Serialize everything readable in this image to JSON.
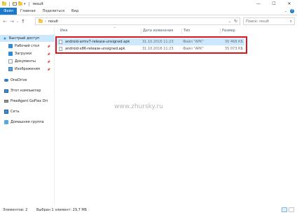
{
  "window": {
    "title": "result",
    "controls": {
      "minimize": "—",
      "maximize": "☐",
      "close": "✕"
    }
  },
  "ribbon": {
    "tabs": [
      "Файл",
      "Главная",
      "Поделиться",
      "Вид"
    ],
    "expand": "⌄",
    "help": "?"
  },
  "address": {
    "breadcrumb": "result",
    "search_placeholder": "Поиск: result"
  },
  "sidebar": {
    "items": [
      {
        "label": "Быстрый доступ",
        "icon": "star-icon",
        "selected": true,
        "pinned": false
      },
      {
        "label": "Рабочий стол",
        "icon": "desktop-icon",
        "pinned": true
      },
      {
        "label": "Загрузки",
        "icon": "downloads-icon",
        "pinned": true
      },
      {
        "label": "Документы",
        "icon": "documents-icon",
        "pinned": true
      },
      {
        "label": "Изображения",
        "icon": "pictures-icon",
        "pinned": true
      },
      {
        "label": "OneDrive",
        "icon": "cloud-icon"
      },
      {
        "label": "Этот компьютер",
        "icon": "computer-icon"
      },
      {
        "label": "FreeAgent GoFlex Dri",
        "icon": "drive-icon"
      },
      {
        "label": "Сеть",
        "icon": "network-icon"
      },
      {
        "label": "Домашняя группа",
        "icon": "homegroup-icon"
      }
    ]
  },
  "columns": {
    "name": "Имя",
    "date": "Дата изменения",
    "type": "Тип",
    "size": "Размер"
  },
  "files": [
    {
      "name": "android-armv7-release-unsigned.apk",
      "date": "31.10.2016 11:23",
      "type": "Файл \"APK\"",
      "size": "30 468 КБ",
      "selected": true
    },
    {
      "name": "android-x86-release-unsigned.apk",
      "date": "31.10.2016 11:23",
      "type": "Файл \"APK\"",
      "size": "35 073 КБ",
      "selected": false
    }
  ],
  "watermark": "www.zhursky.ru",
  "status": {
    "count": "Элементов: 2",
    "selection": "Выбран 1 элемент: 29,7 МБ"
  }
}
